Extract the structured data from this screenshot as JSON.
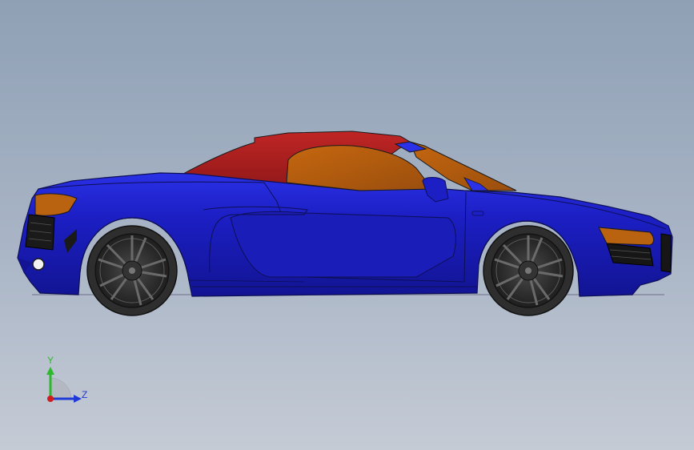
{
  "viewport": {
    "background_top": "#8fa0b5",
    "background_bottom": "#c5cbd5"
  },
  "model": {
    "body_color": "#1c1fc4",
    "roof_color": "#a81e1e",
    "glass_color": "#b35a10",
    "light_color": "#b9620f",
    "tire_color": "#2e2e2e"
  },
  "triad": {
    "y_label": "Y",
    "z_label": "Z",
    "y_color": "#2eb82e",
    "z_color": "#1f3ad6",
    "x_color": "#d01c1c"
  }
}
